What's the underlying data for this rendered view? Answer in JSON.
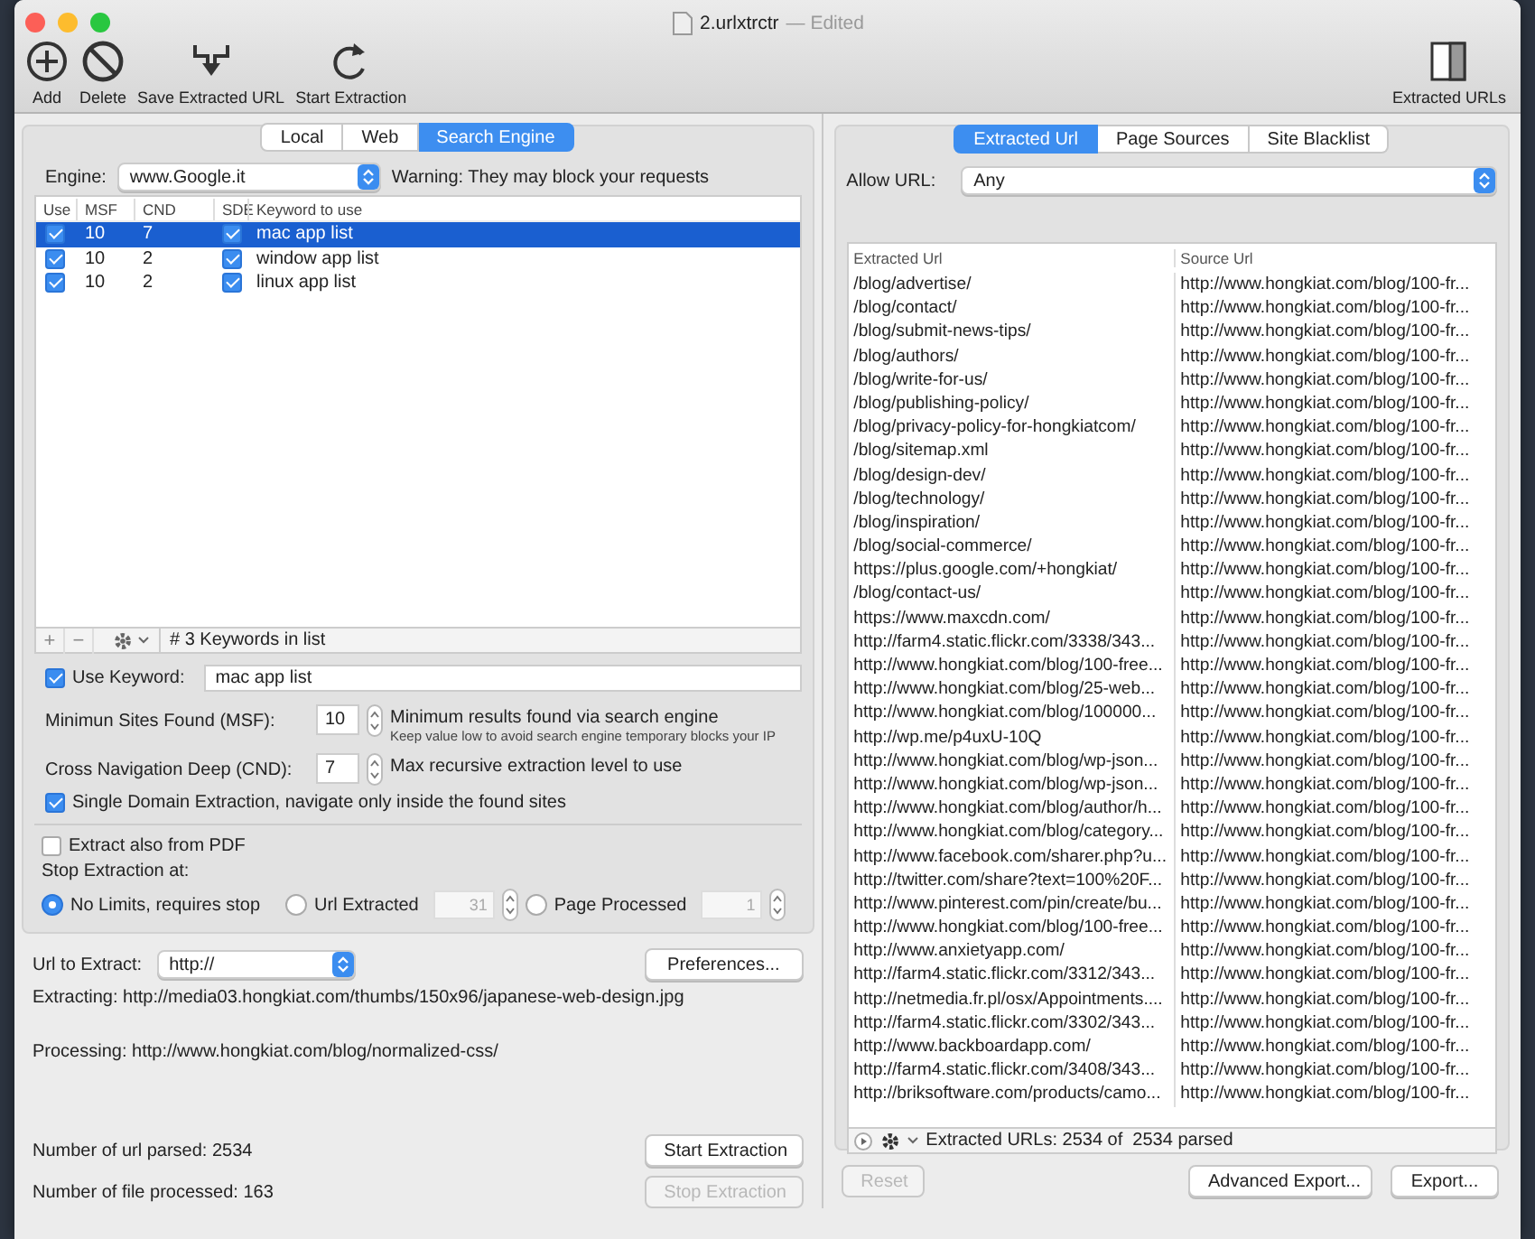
{
  "window": {
    "title": "2.urlxtrctr",
    "subtitle": "— Edited"
  },
  "toolbar": [
    {
      "label": "Add"
    },
    {
      "label": "Delete"
    },
    {
      "label": "Save Extracted URL"
    },
    {
      "label": "Start Extraction"
    }
  ],
  "toolbar_right": {
    "label": "Extracted URLs"
  },
  "source_tabs": [
    {
      "label": "Local",
      "selected": false
    },
    {
      "label": "Web",
      "selected": false
    },
    {
      "label": "Search Engine",
      "selected": true
    }
  ],
  "engine": {
    "label": "Engine:",
    "value": "www.Google.it",
    "warning": "Warning: They may block your requests"
  },
  "keywords": {
    "columns": [
      "Use",
      "MSF",
      "CND",
      "SDE",
      "Keyword to use"
    ],
    "rows": [
      {
        "use": true,
        "msf": "10",
        "cnd": "7",
        "sde": true,
        "keyword": "mac app list",
        "selected": true
      },
      {
        "use": true,
        "msf": "10",
        "cnd": "2",
        "sde": true,
        "keyword": "window app list",
        "selected": false
      },
      {
        "use": true,
        "msf": "10",
        "cnd": "2",
        "sde": true,
        "keyword": "linux app list",
        "selected": false
      }
    ],
    "list_buttons": [
      "+",
      "−"
    ],
    "footer": "# 3 Keywords in list"
  },
  "use_keyword": {
    "label": "Use Keyword:",
    "checked": true,
    "value": "mac app list"
  },
  "msf": {
    "label": "Minimun Sites Found (MSF):",
    "value": "10",
    "hint": "Minimum results found via search engine",
    "note": "Keep value low to avoid search engine temporary blocks your IP"
  },
  "cnd": {
    "label": "Cross Navigation Deep (CND):",
    "value": "7",
    "hint": "Max recursive extraction level to use"
  },
  "single_domain": {
    "label": "Single Domain Extraction, navigate only inside the found sites",
    "checked": true
  },
  "extract_pdf": {
    "label": "Extract also from PDF",
    "checked": false
  },
  "stop_at": {
    "label": "Stop Extraction at:",
    "options": [
      {
        "label": "No Limits, requires stop",
        "selected": true
      },
      {
        "label": "Url Extracted",
        "selected": false,
        "value": "31",
        "field_disabled": true
      },
      {
        "label": "Page Processed",
        "selected": false,
        "value": "1",
        "field_disabled": true
      }
    ]
  },
  "url_to_extract": {
    "label": "Url to Extract:",
    "value": "http://"
  },
  "preferences_button": "Preferences...",
  "extracting": "Extracting: http://media03.hongkiat.com/thumbs/150x96/japanese-web-design.jpg",
  "processing": "Processing: http://www.hongkiat.com/blog/normalized-css/",
  "url_parsed": "Number of url parsed: 2534",
  "files_processed": "Number of file processed: 163",
  "extraction_buttons": [
    {
      "label": "Start Extraction",
      "disabled": false
    },
    {
      "label": "Stop Extraction",
      "disabled": true
    }
  ],
  "result_tabs": [
    {
      "label": "Extracted Url",
      "selected": true
    },
    {
      "label": "Page Sources",
      "selected": false
    },
    {
      "label": "Site Blacklist",
      "selected": false
    }
  ],
  "allow_url": {
    "label": "Allow URL:",
    "value": "Any"
  },
  "results": {
    "columns": [
      "Extracted Url",
      "Source Url"
    ],
    "rows": [
      {
        "extracted": "/blog/advertise/",
        "source": "http://www.hongkiat.com/blog/100-fr..."
      },
      {
        "extracted": "/blog/contact/",
        "source": "http://www.hongkiat.com/blog/100-fr..."
      },
      {
        "extracted": "/blog/submit-news-tips/",
        "source": "http://www.hongkiat.com/blog/100-fr..."
      },
      {
        "extracted": "/blog/authors/",
        "source": "http://www.hongkiat.com/blog/100-fr..."
      },
      {
        "extracted": "/blog/write-for-us/",
        "source": "http://www.hongkiat.com/blog/100-fr..."
      },
      {
        "extracted": "/blog/publishing-policy/",
        "source": "http://www.hongkiat.com/blog/100-fr..."
      },
      {
        "extracted": "/blog/privacy-policy-for-hongkiatcom/",
        "source": "http://www.hongkiat.com/blog/100-fr..."
      },
      {
        "extracted": "/blog/sitemap.xml",
        "source": "http://www.hongkiat.com/blog/100-fr..."
      },
      {
        "extracted": "/blog/design-dev/",
        "source": "http://www.hongkiat.com/blog/100-fr..."
      },
      {
        "extracted": "/blog/technology/",
        "source": "http://www.hongkiat.com/blog/100-fr..."
      },
      {
        "extracted": "/blog/inspiration/",
        "source": "http://www.hongkiat.com/blog/100-fr..."
      },
      {
        "extracted": "/blog/social-commerce/",
        "source": "http://www.hongkiat.com/blog/100-fr..."
      },
      {
        "extracted": "https://plus.google.com/+hongkiat/",
        "source": "http://www.hongkiat.com/blog/100-fr..."
      },
      {
        "extracted": "/blog/contact-us/",
        "source": "http://www.hongkiat.com/blog/100-fr..."
      },
      {
        "extracted": "https://www.maxcdn.com/",
        "source": "http://www.hongkiat.com/blog/100-fr..."
      },
      {
        "extracted": "http://farm4.static.flickr.com/3338/343...",
        "source": "http://www.hongkiat.com/blog/100-fr..."
      },
      {
        "extracted": "http://www.hongkiat.com/blog/100-free...",
        "source": "http://www.hongkiat.com/blog/100-fr..."
      },
      {
        "extracted": "http://www.hongkiat.com/blog/25-web...",
        "source": "http://www.hongkiat.com/blog/100-fr..."
      },
      {
        "extracted": "http://www.hongkiat.com/blog/100000...",
        "source": "http://www.hongkiat.com/blog/100-fr..."
      },
      {
        "extracted": "http://wp.me/p4uxU-10Q",
        "source": "http://www.hongkiat.com/blog/100-fr..."
      },
      {
        "extracted": "http://www.hongkiat.com/blog/wp-json...",
        "source": "http://www.hongkiat.com/blog/100-fr..."
      },
      {
        "extracted": "http://www.hongkiat.com/blog/wp-json...",
        "source": "http://www.hongkiat.com/blog/100-fr..."
      },
      {
        "extracted": "http://www.hongkiat.com/blog/author/h...",
        "source": "http://www.hongkiat.com/blog/100-fr..."
      },
      {
        "extracted": "http://www.hongkiat.com/blog/category...",
        "source": "http://www.hongkiat.com/blog/100-fr..."
      },
      {
        "extracted": "http://www.facebook.com/sharer.php?u...",
        "source": "http://www.hongkiat.com/blog/100-fr..."
      },
      {
        "extracted": "http://twitter.com/share?text=100%20F...",
        "source": "http://www.hongkiat.com/blog/100-fr..."
      },
      {
        "extracted": "http://www.pinterest.com/pin/create/bu...",
        "source": "http://www.hongkiat.com/blog/100-fr..."
      },
      {
        "extracted": "http://www.hongkiat.com/blog/100-free...",
        "source": "http://www.hongkiat.com/blog/100-fr..."
      },
      {
        "extracted": "http://www.anxietyapp.com/",
        "source": "http://www.hongkiat.com/blog/100-fr..."
      },
      {
        "extracted": "http://farm4.static.flickr.com/3312/343...",
        "source": "http://www.hongkiat.com/blog/100-fr..."
      },
      {
        "extracted": "http://netmedia.fr.pl/osx/Appointments....",
        "source": "http://www.hongkiat.com/blog/100-fr..."
      },
      {
        "extracted": "http://farm4.static.flickr.com/3302/343...",
        "source": "http://www.hongkiat.com/blog/100-fr..."
      },
      {
        "extracted": "http://www.backboardapp.com/",
        "source": "http://www.hongkiat.com/blog/100-fr..."
      },
      {
        "extracted": "http://farm4.static.flickr.com/3408/343...",
        "source": "http://www.hongkiat.com/blog/100-fr..."
      },
      {
        "extracted": "http://briksoftware.com/products/camo...",
        "source": "http://www.hongkiat.com/blog/100-fr..."
      }
    ],
    "footer": "Extracted URLs: 2534 of  2534 parsed"
  },
  "bottom_buttons": [
    {
      "label": "Reset",
      "disabled": true
    },
    {
      "label": "Advanced Export...",
      "disabled": false
    },
    {
      "label": "Export...",
      "disabled": false
    }
  ]
}
